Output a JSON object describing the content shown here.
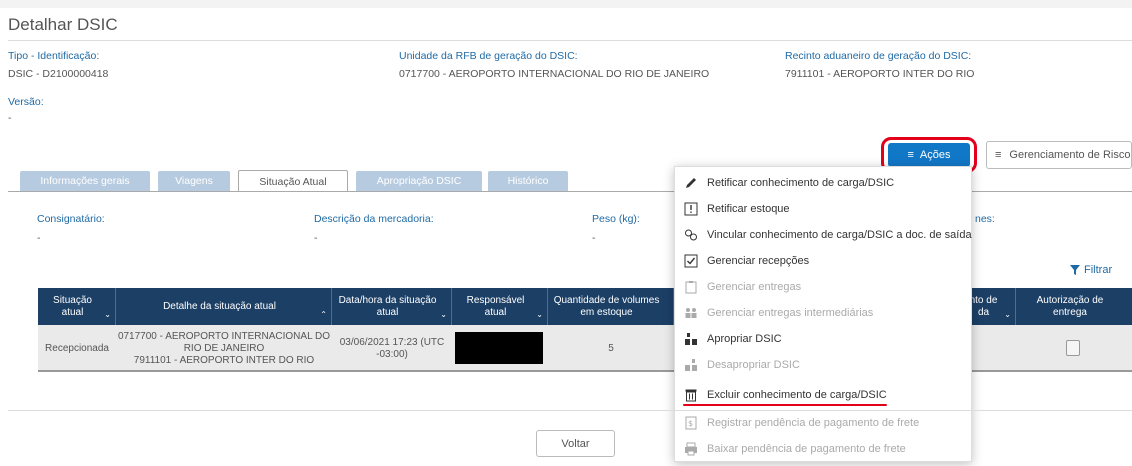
{
  "page": {
    "title": "Detalhar DSIC"
  },
  "info": {
    "tipo_label": "Tipo - Identificação:",
    "tipo_value": "DSIC - D2100000418",
    "unidade_label": "Unidade da RFB de geração do DSIC:",
    "unidade_value": "0717700 - AEROPORTO INTERNACIONAL DO RIO DE JANEIRO",
    "recinto_label": "Recinto aduaneiro de geração do DSIC:",
    "recinto_value": "7911101 - AEROPORTO INTER DO RIO",
    "versao_label": "Versão:",
    "versao_value": "-"
  },
  "actions": {
    "acoes_label": "Ações",
    "risco_label": "Gerenciamento de Risco"
  },
  "tabs": [
    "Informações gerais",
    "Viagens",
    "Situação Atual",
    "Apropriação DSIC",
    "Histórico"
  ],
  "situacao": {
    "consignatario_label": "Consignatário:",
    "consignatario_value": "-",
    "descricao_label": "Descrição da mercadoria:",
    "descricao_value": "-",
    "peso_label": "Peso (kg):",
    "peso_value": "-",
    "partial_label": "nes:",
    "filtrar_label": "Filtrar"
  },
  "table": {
    "headers": [
      "Situação atual",
      "Detalhe da situação atual",
      "Data/hora da situação atual",
      "Responsável atual",
      "Quantidade de volumes em estoque",
      "nto de da",
      "Autorização de entrega"
    ],
    "row": {
      "situacao": "Recepcionada",
      "detalhe_1": "0717700 - AEROPORTO INTERNACIONAL DO",
      "detalhe_2": "RIO DE JANEIRO",
      "detalhe_3": "7911101 - AEROPORTO INTER DO RIO",
      "data_1": "03/06/2021 17:23 (UTC",
      "data_2": "-03:00)",
      "quantidade": "5",
      "partial": "-"
    }
  },
  "menu": {
    "items": [
      {
        "label": "Retificar conhecimento de carga/DSIC",
        "icon": "pencil-icon",
        "enabled": true
      },
      {
        "label": "Retificar estoque",
        "icon": "exclamation-box-icon",
        "enabled": true
      },
      {
        "label": "Vincular conhecimento de carga/DSIC a doc. de saída",
        "icon": "link-icon",
        "enabled": true
      },
      {
        "label": "Gerenciar recepções",
        "icon": "checkbox-icon",
        "enabled": true
      },
      {
        "label": "Gerenciar entregas",
        "icon": "clipboard-icon",
        "enabled": false
      },
      {
        "label": "Gerenciar entregas intermediárias",
        "icon": "people-icon",
        "enabled": false
      },
      {
        "label": "Apropriar DSIC",
        "icon": "allocate-icon",
        "enabled": true
      },
      {
        "label": "Desapropriar DSIC",
        "icon": "deallocate-icon",
        "enabled": false
      },
      {
        "label": "Excluir conhecimento de carga/DSIC",
        "icon": "trash-icon",
        "enabled": true
      },
      {
        "label": "Registrar pendência de pagamento de frete",
        "icon": "money-doc-icon",
        "enabled": false
      },
      {
        "label": "Baixar pendência de pagamento de frete",
        "icon": "printer-icon",
        "enabled": false
      }
    ]
  },
  "footer": {
    "voltar_label": "Voltar"
  },
  "colors": {
    "primary": "#1177c7",
    "header_dark": "#1c3f66",
    "tab_inactive": "#b7cbe0",
    "highlight_red": "#e3001b",
    "label_blue": "#1f6aa5"
  }
}
